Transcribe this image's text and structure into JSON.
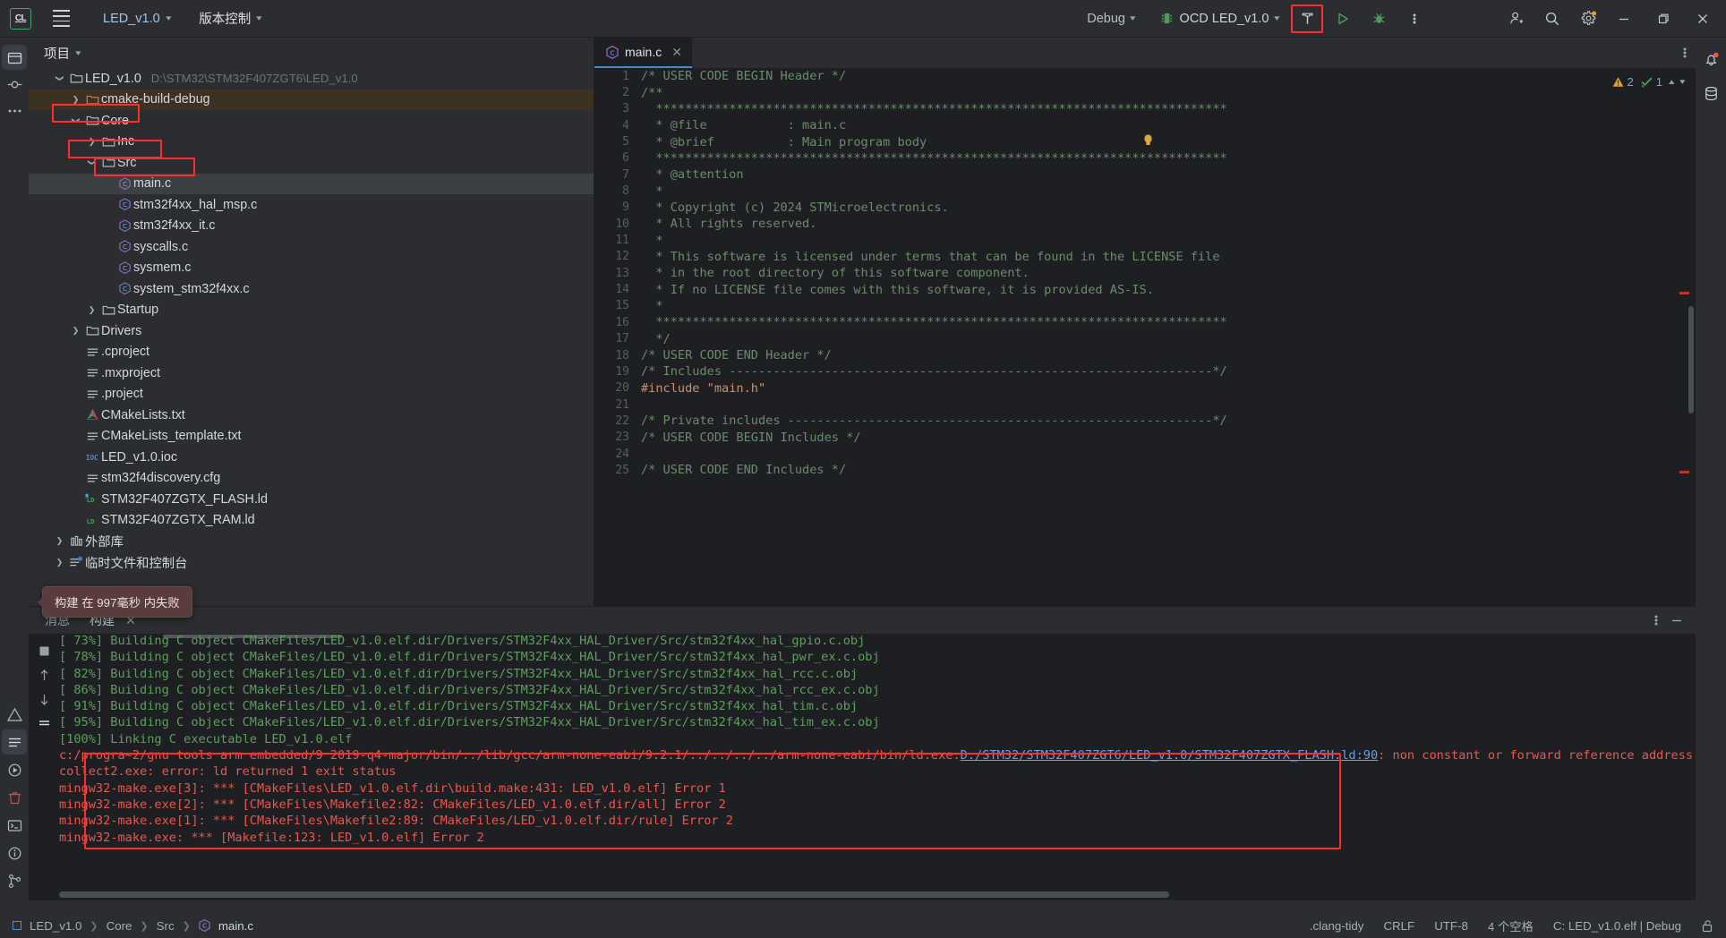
{
  "toolbar": {
    "logo": "CL",
    "menu_icon": "hamburger-menu-icon",
    "project_name": "LED_v1.0",
    "vcs_label": "版本控制",
    "run_config": "Debug",
    "debug_config": "OCD LED_v1.0",
    "build_icon": "hammer-icon",
    "run_icon": "run-triangle-icon",
    "debug_icon": "debug-bug-icon",
    "more_icon": "more-vertical-icon",
    "account_icon": "add-user-icon",
    "search_icon": "search-icon",
    "settings_icon": "gear-icon",
    "minimize_icon": "minimize-icon",
    "maximize_icon": "maximize-icon",
    "close_icon": "close-icon"
  },
  "project_panel": {
    "title": "项目",
    "root": {
      "label": "LED_v1.0",
      "path": "D:\\STM32\\STM32F407ZGT6\\LED_v1.0"
    },
    "tree": [
      {
        "label": "LED_v1.0",
        "path": "D:\\STM32\\STM32F407ZGT6\\LED_v1.0",
        "indent": 0,
        "arrow": "down",
        "icon": "folder-icon",
        "state": "normal"
      },
      {
        "label": "cmake-build-debug",
        "indent": 1,
        "arrow": "right",
        "icon": "folder-orange-icon",
        "state": "amber"
      },
      {
        "label": "Core",
        "indent": 1,
        "arrow": "down",
        "icon": "folder-icon",
        "state": "normal",
        "highlight": true
      },
      {
        "label": "Inc",
        "indent": 2,
        "arrow": "right",
        "icon": "folder-icon",
        "state": "normal"
      },
      {
        "label": "Src",
        "indent": 2,
        "arrow": "down",
        "icon": "folder-icon",
        "state": "normal",
        "highlight": true
      },
      {
        "label": "main.c",
        "indent": 3,
        "arrow": "none",
        "icon": "c-file-icon",
        "state": "selected",
        "highlight": true
      },
      {
        "label": "stm32f4xx_hal_msp.c",
        "indent": 3,
        "arrow": "none",
        "icon": "c-file-icon",
        "state": "normal"
      },
      {
        "label": "stm32f4xx_it.c",
        "indent": 3,
        "arrow": "none",
        "icon": "c-file-icon",
        "state": "normal"
      },
      {
        "label": "syscalls.c",
        "indent": 3,
        "arrow": "none",
        "icon": "c-file-icon",
        "state": "normal"
      },
      {
        "label": "sysmem.c",
        "indent": 3,
        "arrow": "none",
        "icon": "c-file-icon",
        "state": "normal"
      },
      {
        "label": "system_stm32f4xx.c",
        "indent": 3,
        "arrow": "none",
        "icon": "c-file-icon",
        "state": "normal"
      },
      {
        "label": "Startup",
        "indent": 2,
        "arrow": "right",
        "icon": "folder-icon",
        "state": "normal"
      },
      {
        "label": "Drivers",
        "indent": 1,
        "arrow": "right",
        "icon": "folder-icon",
        "state": "normal"
      },
      {
        "label": ".cproject",
        "indent": 1,
        "arrow": "none",
        "icon": "text-file-icon",
        "state": "normal"
      },
      {
        "label": ".mxproject",
        "indent": 1,
        "arrow": "none",
        "icon": "text-file-icon",
        "state": "normal"
      },
      {
        "label": ".project",
        "indent": 1,
        "arrow": "none",
        "icon": "text-file-icon",
        "state": "normal"
      },
      {
        "label": "CMakeLists.txt",
        "indent": 1,
        "arrow": "none",
        "icon": "cmake-file-icon",
        "state": "normal"
      },
      {
        "label": "CMakeLists_template.txt",
        "indent": 1,
        "arrow": "none",
        "icon": "text-file-icon",
        "state": "normal"
      },
      {
        "label": "LED_v1.0.ioc",
        "indent": 1,
        "arrow": "none",
        "icon": "ioc-file-icon",
        "state": "normal"
      },
      {
        "label": "stm32f4discovery.cfg",
        "indent": 1,
        "arrow": "none",
        "icon": "text-file-icon",
        "state": "normal"
      },
      {
        "label": "STM32F407ZGTX_FLASH.ld",
        "indent": 1,
        "arrow": "none",
        "icon": "ld-file-icon",
        "state": "normal"
      },
      {
        "label": "STM32F407ZGTX_RAM.ld",
        "indent": 1,
        "arrow": "none",
        "icon": "ld-plain-file-icon",
        "state": "normal"
      },
      {
        "label": "外部库",
        "indent": 0,
        "arrow": "right",
        "icon": "library-icon",
        "state": "normal"
      },
      {
        "label": "临时文件和控制台",
        "indent": 0,
        "arrow": "right",
        "icon": "scratches-icon",
        "state": "normal"
      }
    ]
  },
  "editor": {
    "tab": {
      "label": "main.c",
      "icon": "c-file-icon",
      "close_icon": "close-icon"
    },
    "inspector": {
      "warnings": "2",
      "checks": "1",
      "warn_icon": "warning-triangle-icon",
      "ok_icon": "inspection-ok-icon",
      "up_icon": "chevron-up-icon",
      "down_icon": "chevron-down-icon"
    },
    "more_icon": "more-vertical-icon",
    "bulb_icon": "lightbulb-icon",
    "lines": [
      {
        "n": "1",
        "text": "/* USER CODE BEGIN Header */",
        "cls": "cmt"
      },
      {
        "n": "2",
        "text": "/**",
        "cls": "cmt"
      },
      {
        "n": "3",
        "text": "  ******************************************************************************",
        "cls": "cmt"
      },
      {
        "n": "4",
        "text": "  * @file           : main.c",
        "cls": "cmt"
      },
      {
        "n": "5",
        "text": "  * @brief          : Main program body",
        "cls": "cmt"
      },
      {
        "n": "6",
        "text": "  ******************************************************************************",
        "cls": "cmt"
      },
      {
        "n": "7",
        "text": "  * @attention",
        "cls": "cmt"
      },
      {
        "n": "8",
        "text": "  *",
        "cls": "cmt"
      },
      {
        "n": "9",
        "text": "  * Copyright (c) 2024 STMicroelectronics.",
        "cls": "cmt"
      },
      {
        "n": "10",
        "text": "  * All rights reserved.",
        "cls": "cmt"
      },
      {
        "n": "11",
        "text": "  *",
        "cls": "cmt"
      },
      {
        "n": "12",
        "text": "  * This software is licensed under terms that can be found in the LICENSE file",
        "cls": "cmt"
      },
      {
        "n": "13",
        "text": "  * in the root directory of this software component.",
        "cls": "cmt"
      },
      {
        "n": "14",
        "text": "  * If no LICENSE file comes with this software, it is provided AS-IS.",
        "cls": "cmt"
      },
      {
        "n": "15",
        "text": "  *",
        "cls": "cmt"
      },
      {
        "n": "16",
        "text": "  ******************************************************************************",
        "cls": "cmt"
      },
      {
        "n": "17",
        "text": "  */",
        "cls": "cmt"
      },
      {
        "n": "18",
        "text": "/* USER CODE END Header */",
        "cls": "cmt"
      },
      {
        "n": "19",
        "text": "/* Includes ------------------------------------------------------------------*/",
        "cls": "cmt"
      },
      {
        "n": "20",
        "text": "#include \"main.h\"",
        "cls": "kw"
      },
      {
        "n": "21",
        "text": "",
        "cls": "cmt"
      },
      {
        "n": "22",
        "text": "/* Private includes ----------------------------------------------------------*/",
        "cls": "cmt"
      },
      {
        "n": "23",
        "text": "/* USER CODE BEGIN Includes */",
        "cls": "cmt"
      },
      {
        "n": "24",
        "text": "",
        "cls": "cmt"
      },
      {
        "n": "25",
        "text": "/* USER CODE END Includes */",
        "cls": "cmt"
      }
    ]
  },
  "console": {
    "tabs": [
      {
        "label": "消息",
        "active": false
      },
      {
        "label": "构建",
        "active": true,
        "close_icon": "close-icon"
      }
    ],
    "more_icon": "more-vertical-icon",
    "collapse_icon": "minimize-icon",
    "tooltip": "构建 在 997毫秒 内失败",
    "rail_icons": [
      "stop-icon",
      "up-arrow-icon",
      "down-arrow-icon",
      "filter-icon"
    ],
    "lines": [
      {
        "text": "[ 73%] Building C object CMakeFiles/LED_v1.0.elf.dir/Drivers/STM32F4xx_HAL_Driver/Src/stm32f4xx_hal_gpio.c.obj",
        "type": "ok"
      },
      {
        "text": "[ 78%] Building C object CMakeFiles/LED_v1.0.elf.dir/Drivers/STM32F4xx_HAL_Driver/Src/stm32f4xx_hal_pwr_ex.c.obj",
        "type": "ok"
      },
      {
        "text": "[ 82%] Building C object CMakeFiles/LED_v1.0.elf.dir/Drivers/STM32F4xx_HAL_Driver/Src/stm32f4xx_hal_rcc.c.obj",
        "type": "ok"
      },
      {
        "text": "[ 86%] Building C object CMakeFiles/LED_v1.0.elf.dir/Drivers/STM32F4xx_HAL_Driver/Src/stm32f4xx_hal_rcc_ex.c.obj",
        "type": "ok"
      },
      {
        "text": "[ 91%] Building C object CMakeFiles/LED_v1.0.elf.dir/Drivers/STM32F4xx_HAL_Driver/Src/stm32f4xx_hal_tim.c.obj",
        "type": "ok"
      },
      {
        "text": "[ 95%] Building C object CMakeFiles/LED_v1.0.elf.dir/Drivers/STM32F4xx_HAL_Driver/Src/stm32f4xx_hal_tim_ex.c.obj",
        "type": "ok"
      },
      {
        "text": "[100%] Linking C executable LED_v1.0.elf",
        "type": "ok"
      }
    ],
    "error_lines": [
      {
        "pre": "c:/progra~2/gnu tools arm embedded/9 2019-q4-major/bin/../lib/gcc/arm-none-eabi/9.2.1/../../../../arm-none-eabi/bin/ld.exe:",
        "link": "D:/STM32/STM32F407ZGT6/LED_v1.0/STM32F407ZGTX_FLASH.ld:90",
        "post": ": non constant or forward reference address e"
      },
      {
        "pre": "collect2.exe: error: ld returned 1 exit status",
        "link": "",
        "post": ""
      },
      {
        "pre": "mingw32-make.exe[3]: *** [CMakeFiles\\LED_v1.0.elf.dir\\build.make:431: LED_v1.0.elf] Error 1",
        "link": "",
        "post": ""
      },
      {
        "pre": "mingw32-make.exe[2]: *** [CMakeFiles\\Makefile2:82: CMakeFiles/LED_v1.0.elf.dir/all] Error 2",
        "link": "",
        "post": ""
      },
      {
        "pre": "mingw32-make.exe[1]: *** [CMakeFiles\\Makefile2:89: CMakeFiles/LED_v1.0.elf.dir/rule] Error 2",
        "link": "",
        "post": ""
      },
      {
        "pre": "mingw32-make.exe: *** [Makefile:123: LED_v1.0.elf] Error 2",
        "link": "",
        "post": ""
      }
    ]
  },
  "status_bar": {
    "breadcrumbs": [
      "LED_v1.0",
      "Core",
      "Src",
      "main.c"
    ],
    "file_icon": "c-file-icon",
    "items": [
      ".clang-tidy",
      "CRLF",
      "UTF-8",
      "4 个空格",
      "C: LED_v1.0.elf | Debug"
    ],
    "lock_icon": "unlocked-icon"
  },
  "rails": {
    "left_icons": [
      "project-folder-icon",
      "commit-icon",
      "more-dots-icon"
    ],
    "left_bottom_icons": [
      "problems-warning-icon",
      "terminal-list-icon",
      "run-circle-icon",
      "trash-icon",
      "terminal-icon",
      "info-circle-icon",
      "git-branch-icon"
    ],
    "right_icons": [
      "notifications-bell-icon",
      "database-icon"
    ]
  },
  "colors": {
    "accent_blue": "#4a88c7",
    "error_red": "#e8584f",
    "box_red": "#ff2d2d",
    "ok_green": "#5e9e5e",
    "panel_bg": "#2b2d30",
    "editor_bg": "#1e1f22"
  }
}
